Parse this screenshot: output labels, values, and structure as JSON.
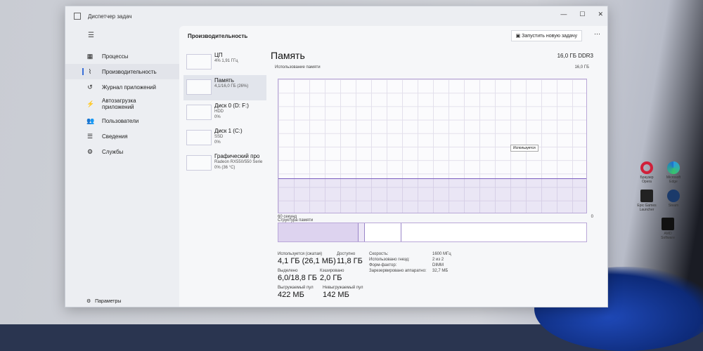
{
  "window": {
    "title": "Диспетчер задач",
    "controls": [
      "—",
      "☐",
      "✕"
    ]
  },
  "sidebar": {
    "items": [
      {
        "icon": "▦",
        "label": "Процессы"
      },
      {
        "icon": "⌇",
        "label": "Производительность"
      },
      {
        "icon": "↺",
        "label": "Журнал приложений"
      },
      {
        "icon": "⚡",
        "label": "Автозагрузка приложений"
      },
      {
        "icon": "👥",
        "label": "Пользователи"
      },
      {
        "icon": "☰",
        "label": "Сведения"
      },
      {
        "icon": "⚙",
        "label": "Службы"
      }
    ],
    "settings": "Параметры"
  },
  "header": {
    "title": "Производительность",
    "run_task": "Запустить новую задачу",
    "more": "···"
  },
  "devices": [
    {
      "name": "ЦП",
      "sub1": "4% 1,91 ГГц",
      "sub2": ""
    },
    {
      "name": "Память",
      "sub1": "4,1/16,0 ГБ (26%)",
      "sub2": ""
    },
    {
      "name": "Диск 0 (D: F:)",
      "sub1": "HDD",
      "sub2": "0%"
    },
    {
      "name": "Диск 1 (C:)",
      "sub1": "SSD",
      "sub2": "0%"
    },
    {
      "name": "Графический про",
      "sub1": "Radeon RX550/550 Serie",
      "sub2": "0% (36 °C)"
    }
  ],
  "memory": {
    "title": "Память",
    "type": "16,0 ГБ DDR3",
    "usage_label": "Использование памяти",
    "max": "16,0 ГБ",
    "min": "0",
    "time": "60 секунд",
    "tooltip": "Используется",
    "structure": "Структура памяти",
    "usage_percent": 26,
    "stats": [
      {
        "label": "Используется (сжатая)",
        "value": "4,1 ГБ (26,1 МБ)"
      },
      {
        "label": "Доступно",
        "value": "11,8 ГБ"
      },
      {
        "label": "Выделено",
        "value": "6,0/18,8 ГБ"
      },
      {
        "label": "Кэшировано",
        "value": "2,0 ГБ"
      },
      {
        "label": "Выгружаемый пул",
        "value": "422 МБ"
      },
      {
        "label": "Невыгружаемый пул",
        "value": "142 МБ"
      }
    ],
    "props": [
      {
        "k": "Скорость:",
        "v": "1600 МГц"
      },
      {
        "k": "Использовано гнезд:",
        "v": "2 из 2"
      },
      {
        "k": "Форм-фактор:",
        "v": "DIMM"
      },
      {
        "k": "Зарезервировано аппаратно:",
        "v": "32,7 МБ"
      }
    ]
  },
  "desktop": [
    {
      "label": "Браузер Opera"
    },
    {
      "label": "Microsoft Edge"
    },
    {
      "label": "Epic Games Launcher"
    },
    {
      "label": "Steam"
    },
    {
      "label": "AMD Software"
    }
  ]
}
